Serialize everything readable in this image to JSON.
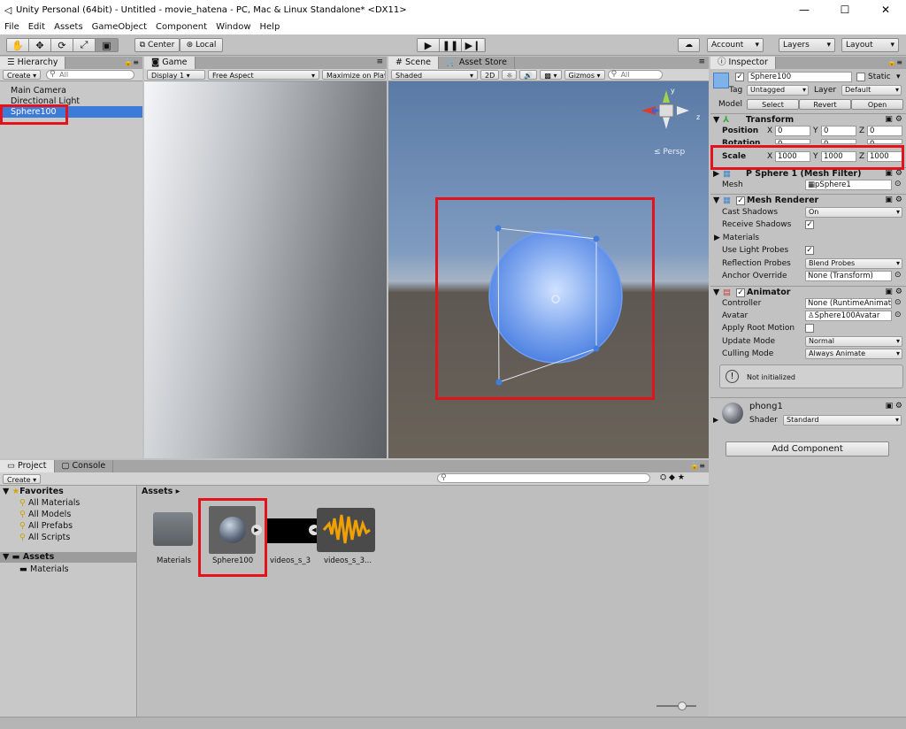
{
  "window": {
    "title": "Unity Personal (64bit) - Untitled - movie_hatena - PC, Mac & Linux Standalone* <DX11>",
    "min": "—",
    "max": "☐",
    "close": "✕"
  },
  "menu": [
    "File",
    "Edit",
    "Assets",
    "GameObject",
    "Component",
    "Window",
    "Help"
  ],
  "toolbar": {
    "center": "Center",
    "local": "Local",
    "account": "Account",
    "layers": "Layers",
    "layout": "Layout"
  },
  "hierarchy": {
    "tab": "Hierarchy",
    "create": "Create",
    "search": "All",
    "items": [
      "Main Camera",
      "Directional Light",
      "Sphere100"
    ]
  },
  "game": {
    "tab": "Game",
    "display": "Display 1",
    "aspect": "Free Aspect",
    "maximize": "Maximize on Play"
  },
  "scene": {
    "tab": "Scene",
    "asset_tab": "Asset Store",
    "shaded": "Shaded",
    "mode2d": "2D",
    "gizmos": "Gizmos",
    "search": "All",
    "persp": "Persp",
    "axis_y": "y",
    "axis_z": "z"
  },
  "inspector": {
    "tab": "Inspector",
    "name": "Sphere100",
    "static": "Static",
    "tag_label": "Tag",
    "tag": "Untagged",
    "layer_label": "Layer",
    "layer": "Default",
    "model_label": "Model",
    "select": "Select",
    "revert": "Revert",
    "open": "Open",
    "transform": {
      "title": "Transform",
      "position": "Position",
      "rotation": "Rotation",
      "scale": "Scale",
      "pos": [
        "0",
        "0",
        "0"
      ],
      "rot": [
        "0",
        "0",
        "0"
      ],
      "scl": [
        "1000",
        "1000",
        "1000"
      ]
    },
    "axes": [
      "X",
      "Y",
      "Z"
    ],
    "mesh_filter": {
      "title": "P Sphere 1 (Mesh Filter)",
      "mesh_label": "Mesh",
      "mesh": "pSphere1"
    },
    "mesh_renderer": {
      "title": "Mesh Renderer",
      "cast_shadows_label": "Cast Shadows",
      "cast_shadows": "On",
      "receive_shadows_label": "Receive Shadows",
      "materials_label": "Materials",
      "light_probes_label": "Use Light Probes",
      "reflection_label": "Reflection Probes",
      "reflection": "Blend Probes",
      "anchor_label": "Anchor Override",
      "anchor": "None (Transform)"
    },
    "animator": {
      "title": "Animator",
      "controller_label": "Controller",
      "controller": "None (RuntimeAnimatorController)",
      "avatar_label": "Avatar",
      "avatar": "Sphere100Avatar",
      "root_motion_label": "Apply Root Motion",
      "update_label": "Update Mode",
      "update": "Normal",
      "culling_label": "Culling Mode",
      "culling": "Always Animate",
      "warning": "Not initialized"
    },
    "material": {
      "name": "phong1",
      "shader_label": "Shader",
      "shader": "Standard"
    },
    "add_component": "Add Component"
  },
  "project": {
    "tab": "Project",
    "console_tab": "Console",
    "create": "Create",
    "favorites": "Favorites",
    "fav_items": [
      "All Materials",
      "All Models",
      "All Prefabs",
      "All Scripts"
    ],
    "assets_label": "Assets",
    "assets_children": [
      "Materials"
    ],
    "breadcrumb": "Assets ▸",
    "files": [
      "Materials",
      "Sphere100",
      "videos_s_3",
      "videos_s_3..."
    ]
  }
}
